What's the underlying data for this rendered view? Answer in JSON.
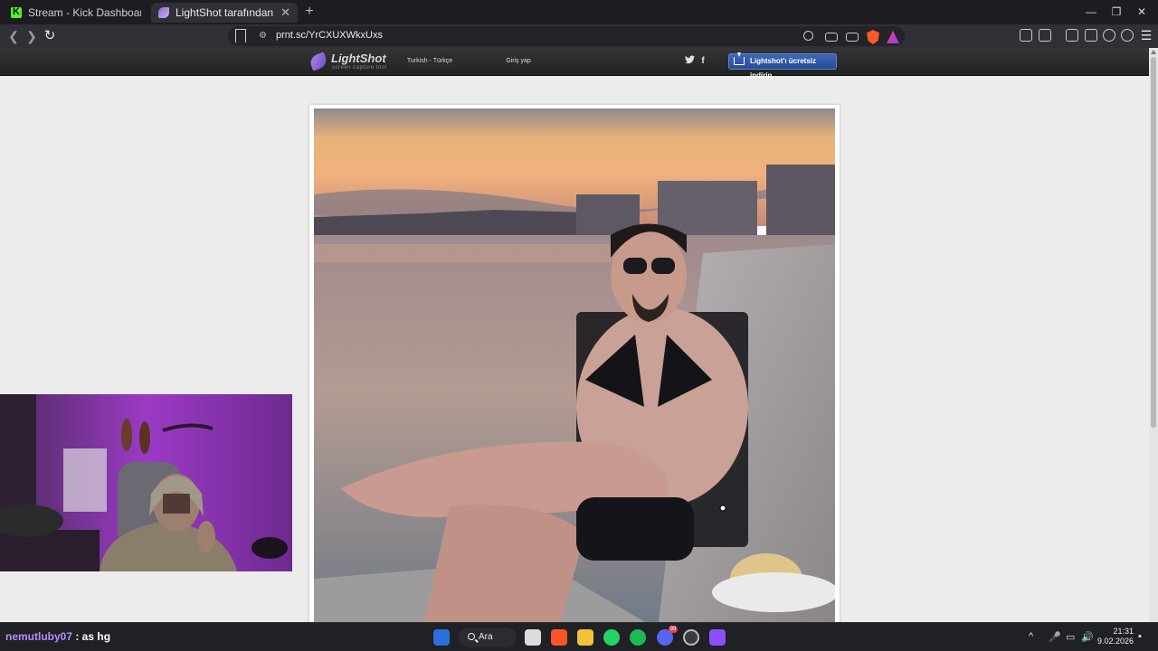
{
  "browser": {
    "tabs": [
      {
        "title": "Stream - Kick Dashboard",
        "active": false
      },
      {
        "title": "LightShot tarafından Ekran Görü",
        "active": true
      }
    ],
    "url": "prnt.sc/YrCXUXWkxUxs"
  },
  "lightshot": {
    "logo_name": "LightShot",
    "logo_tagline": "screen capture tool",
    "language": "Turkish - Türkçe",
    "login": "Giriş yap",
    "download_button": "Lightshot'ı ücretsiz indirin",
    "social": {
      "twitter_glyph": "🐦",
      "facebook_glyph": "f"
    }
  },
  "taskbar": {
    "chat_user": "nemutluby07",
    "chat_message": " : as hg",
    "search_label": "Ara",
    "discord_badge": "99",
    "time": "21:31",
    "date": "9.02.2026"
  },
  "colors": {
    "kick_green": "#53fc18",
    "lightshot_button": "#3f68b8",
    "chat_user": "#b58cff"
  }
}
